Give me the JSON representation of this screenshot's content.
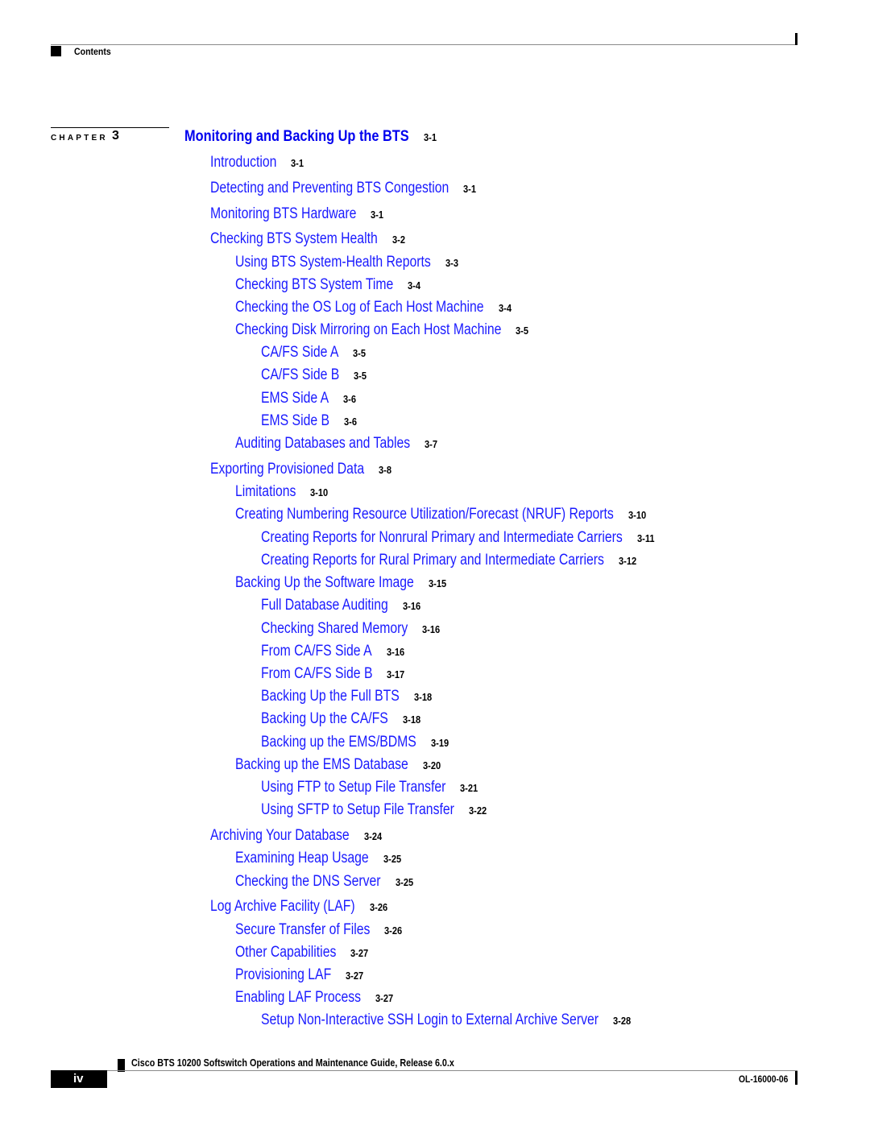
{
  "header": {
    "section_label": "Contents"
  },
  "chapter": {
    "label": "CHAPTER",
    "number": "3",
    "title": "Monitoring and Backing Up the BTS",
    "page": "3-1"
  },
  "toc": [
    {
      "level": 1,
      "title": "Introduction",
      "page": "3-1"
    },
    {
      "level": 1,
      "title": "Detecting and Preventing BTS Congestion",
      "page": "3-1"
    },
    {
      "level": 1,
      "title": "Monitoring BTS Hardware",
      "page": "3-1"
    },
    {
      "level": 1,
      "title": "Checking BTS System Health",
      "page": "3-2"
    },
    {
      "level": 2,
      "title": "Using BTS System-Health Reports",
      "page": "3-3"
    },
    {
      "level": 2,
      "title": "Checking BTS System Time",
      "page": "3-4"
    },
    {
      "level": 2,
      "title": "Checking the OS Log of Each Host Machine",
      "page": "3-4"
    },
    {
      "level": 2,
      "title": "Checking Disk Mirroring on Each Host Machine",
      "page": "3-5"
    },
    {
      "level": 3,
      "title": "CA/FS Side A",
      "page": "3-5"
    },
    {
      "level": 3,
      "title": "CA/FS Side B",
      "page": "3-5"
    },
    {
      "level": 3,
      "title": "EMS Side A",
      "page": "3-6"
    },
    {
      "level": 3,
      "title": "EMS Side B",
      "page": "3-6"
    },
    {
      "level": 2,
      "title": "Auditing Databases and Tables",
      "page": "3-7"
    },
    {
      "level": 1,
      "title": "Exporting Provisioned Data",
      "page": "3-8"
    },
    {
      "level": 2,
      "title": "Limitations",
      "page": "3-10"
    },
    {
      "level": 2,
      "title": "Creating Numbering Resource Utilization/Forecast (NRUF) Reports",
      "page": "3-10"
    },
    {
      "level": 3,
      "title": "Creating Reports for Nonrural Primary and Intermediate Carriers",
      "page": "3-11"
    },
    {
      "level": 3,
      "title": "Creating Reports for Rural Primary and Intermediate Carriers",
      "page": "3-12"
    },
    {
      "level": 2,
      "title": "Backing Up the Software Image",
      "page": "3-15"
    },
    {
      "level": 3,
      "title": "Full Database Auditing",
      "page": "3-16"
    },
    {
      "level": 3,
      "title": "Checking Shared Memory",
      "page": "3-16"
    },
    {
      "level": 3,
      "title": "From CA/FS Side A",
      "page": "3-16"
    },
    {
      "level": 3,
      "title": "From CA/FS Side B",
      "page": "3-17"
    },
    {
      "level": 3,
      "title": "Backing Up the Full BTS",
      "page": "3-18"
    },
    {
      "level": 3,
      "title": "Backing Up the CA/FS",
      "page": "3-18"
    },
    {
      "level": 3,
      "title": "Backing up the EMS/BDMS",
      "page": "3-19"
    },
    {
      "level": 2,
      "title": "Backing up the EMS Database",
      "page": "3-20"
    },
    {
      "level": 3,
      "title": "Using FTP to Setup File Transfer",
      "page": "3-21"
    },
    {
      "level": 3,
      "title": "Using SFTP to Setup File Transfer",
      "page": "3-22"
    },
    {
      "level": 1,
      "title": "Archiving Your Database",
      "page": "3-24"
    },
    {
      "level": 2,
      "title": "Examining Heap Usage",
      "page": "3-25"
    },
    {
      "level": 2,
      "title": "Checking the DNS Server",
      "page": "3-25"
    },
    {
      "level": 1,
      "title": "Log Archive Facility (LAF)",
      "page": "3-26"
    },
    {
      "level": 2,
      "title": "Secure Transfer of Files",
      "page": "3-26"
    },
    {
      "level": 2,
      "title": "Other Capabilities",
      "page": "3-27"
    },
    {
      "level": 2,
      "title": "Provisioning LAF",
      "page": "3-27"
    },
    {
      "level": 2,
      "title": "Enabling LAF Process",
      "page": "3-27"
    },
    {
      "level": 3,
      "title": "Setup Non-Interactive SSH Login to External Archive Server",
      "page": "3-28"
    }
  ],
  "footer": {
    "book_title": "Cisco BTS 10200 Softswitch Operations and Maintenance Guide, Release 6.0.x",
    "page_number": "iv",
    "doc_number": "OL-16000-06"
  }
}
